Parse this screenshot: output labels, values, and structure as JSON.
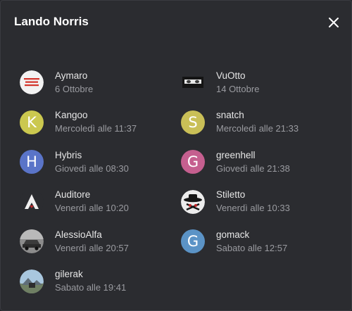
{
  "dialog": {
    "title": "Lando Norris",
    "close_icon": "close-icon"
  },
  "avatar_colors": {
    "kangoo": "#cbc84f",
    "snatch": "#c9bf57",
    "hybris": "#5a74c8",
    "greenhell": "#c55f8f",
    "gomack": "#5b93c6"
  },
  "items": [
    {
      "name": "Aymaro",
      "time": "6 Ottobre",
      "avatar_letter": "",
      "avatar_icon": "red-text-logo-icon"
    },
    {
      "name": "VuOtto",
      "time": "14 Ottobre",
      "avatar_letter": "",
      "avatar_icon": "eyes-photo-icon"
    },
    {
      "name": "Kangoo",
      "time": "Mercoledì alle 11:37",
      "avatar_letter": "K"
    },
    {
      "name": "snatch",
      "time": "Mercoledì alle 21:33",
      "avatar_letter": "S"
    },
    {
      "name": "Hybris",
      "time": "Giovedì alle 08:30",
      "avatar_letter": "H"
    },
    {
      "name": "greenhell",
      "time": "Giovedì alle 21:38",
      "avatar_letter": "G"
    },
    {
      "name": "Auditore",
      "time": "Venerdì alle 10:20",
      "avatar_letter": "",
      "avatar_icon": "assassin-logo-icon"
    },
    {
      "name": "Stiletto",
      "time": "Venerdì alle 10:33",
      "avatar_letter": "",
      "avatar_icon": "hat-emblem-icon"
    },
    {
      "name": "AlessioAlfa",
      "time": "Venerdì alle 20:57",
      "avatar_letter": "",
      "avatar_icon": "car-photo-icon"
    },
    {
      "name": "gomack",
      "time": "Sabato alle 12:57",
      "avatar_letter": "G"
    },
    {
      "name": "gilerak",
      "time": "Sabato alle 19:41",
      "avatar_letter": "",
      "avatar_icon": "landscape-photo-icon"
    }
  ]
}
